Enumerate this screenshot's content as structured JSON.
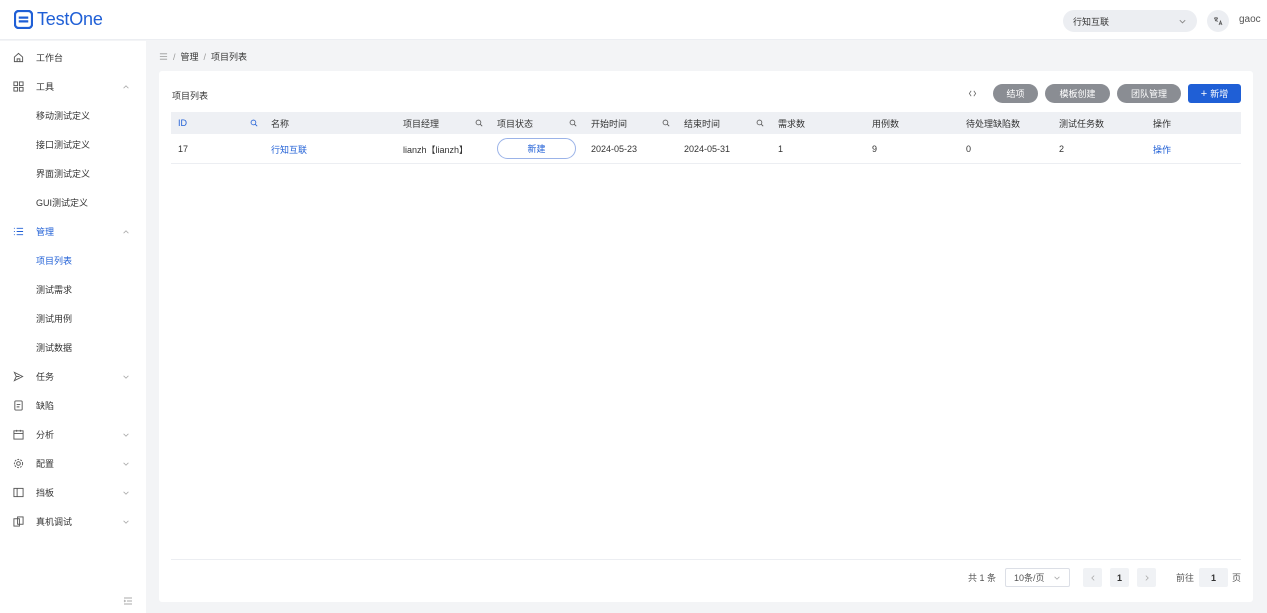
{
  "brand": {
    "name": "TestOne",
    "color": "#1f5fd6"
  },
  "header": {
    "org": "行知互联",
    "lang_icon": "translate-icon",
    "user": "gaoc"
  },
  "sidebar": {
    "items": [
      {
        "label": "工作台",
        "icon": "home-icon"
      },
      {
        "label": "工具",
        "icon": "grid-icon",
        "children": [
          "移动测试定义",
          "接口测试定义",
          "界面测试定义",
          "GUI测试定义"
        ]
      },
      {
        "label": "管理",
        "icon": "list-icon",
        "children": [
          "项目列表",
          "测试需求",
          "测试用例",
          "测试数据"
        ]
      },
      {
        "label": "任务",
        "icon": "send-icon"
      },
      {
        "label": "缺陷",
        "icon": "document-icon"
      },
      {
        "label": "分析",
        "icon": "calendar-icon"
      },
      {
        "label": "配置",
        "icon": "gear-icon"
      },
      {
        "label": "挡板",
        "icon": "panel-icon"
      },
      {
        "label": "真机调试",
        "icon": "device-icon"
      }
    ],
    "active_child": "项目列表"
  },
  "breadcrumb": {
    "items": [
      "管理",
      "项目列表"
    ],
    "separator": "/"
  },
  "panel": {
    "title": "项目列表",
    "buttons": {
      "close": "结项",
      "template": "模板创建",
      "team": "团队管理",
      "add": "新增"
    }
  },
  "table": {
    "headers": {
      "id": "ID",
      "name": "名称",
      "manager": "项目经理",
      "status": "项目状态",
      "start": "开始时间",
      "end": "结束时间",
      "req": "需求数",
      "cases": "用例数",
      "defects": "待处理缺陷数",
      "tasks": "测试任务数",
      "ops": "操作"
    },
    "rows": [
      {
        "id": "17",
        "name": "行知互联",
        "manager": "lianzh【lianzh】",
        "status": "新建",
        "start": "2024-05-23",
        "end": "2024-05-31",
        "req": "1",
        "cases": "9",
        "defects": "0",
        "tasks": "2",
        "ops": "操作"
      }
    ]
  },
  "pagination": {
    "total": "共 1 条",
    "page_size": "10条/页",
    "current": "1",
    "goto_label": "前往",
    "goto_value": "1",
    "unit": "页"
  }
}
